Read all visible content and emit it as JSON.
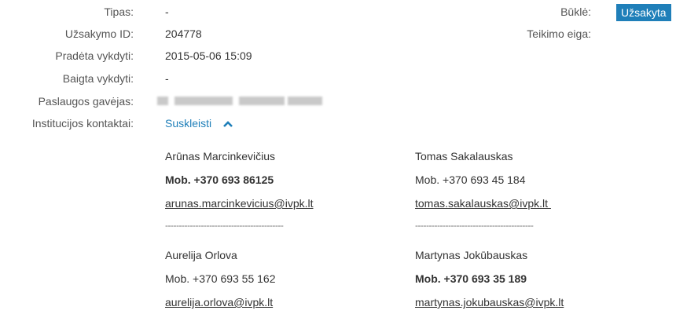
{
  "fields": {
    "type_label": "Tipas:",
    "type_value": "-",
    "order_id_label": "Užsakymo ID:",
    "order_id_value": "204778",
    "started_label": "Pradėta vykdyti:",
    "started_value": "2015-05-06 15:09",
    "finished_label": "Baigta vykdyti:",
    "finished_value": "-",
    "recipient_label": "Paslaugos gavėjas:",
    "contacts_label": "Institucijos kontaktai:"
  },
  "status": {
    "label": "Būklė:",
    "badge": "Užsakyta",
    "progress_label": "Teikimo eiga:"
  },
  "toggle": {
    "label": "Suskleisti",
    "icon": "chevron-up-icon"
  },
  "separator": "-------------------------------------------",
  "contacts": [
    {
      "name": "Arūnas Marcinkevičius",
      "phone": "Mob. +370 693 86125",
      "email": "arunas.marcinkevicius@ivpk.lt",
      "phone_bold": true
    },
    {
      "name": "Tomas Sakalauskas",
      "phone": "Mob. +370 693 45 184",
      "email": "tomas.sakalauskas@ivpk.lt ",
      "phone_bold": false
    },
    {
      "name": "Aurelija Orlova",
      "phone": "Mob. +370 693 55 162",
      "email": "aurelija.orlova@ivpk.lt",
      "phone_bold": false
    },
    {
      "name": "Martynas Jokūbauskas",
      "phone": "Mob. +370 693 35 189",
      "email": "martynas.jokubauskas@ivpk.lt",
      "phone_bold": true
    }
  ],
  "colors": {
    "accent": "#1f7fb9",
    "badge_text": "#ffffff"
  }
}
